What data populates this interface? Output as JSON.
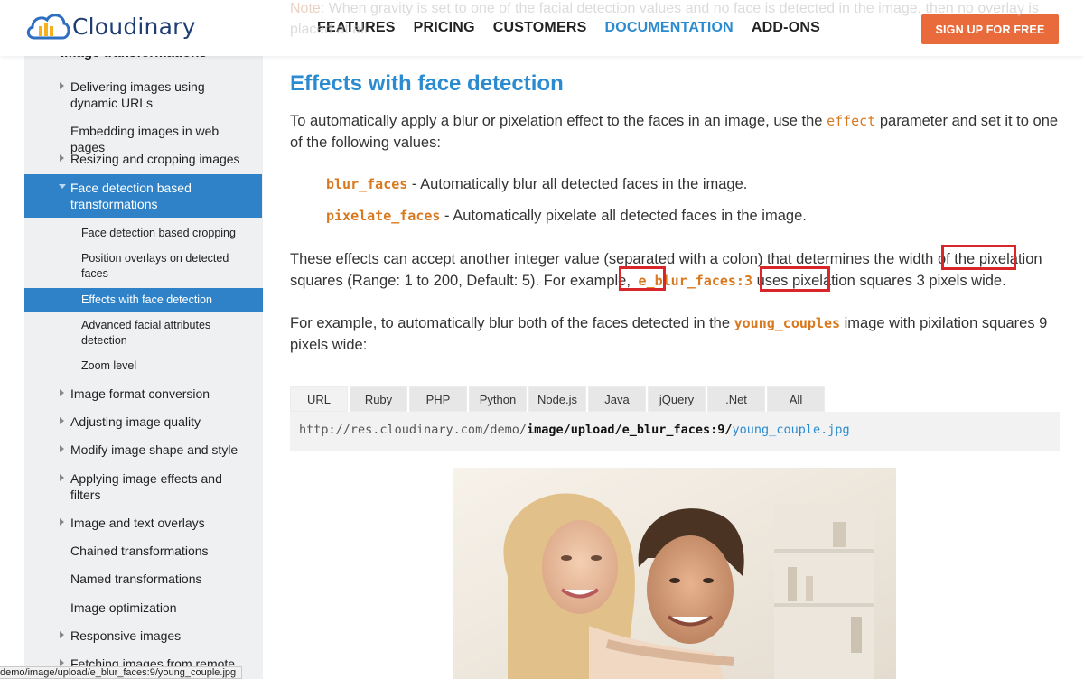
{
  "header": {
    "logo_text": "Cloudinary",
    "nav": [
      "FEATURES",
      "PRICING",
      "CUSTOMERS",
      "DOCUMENTATION",
      "ADD-ONS"
    ],
    "active_nav": "DOCUMENTATION",
    "signup_label": "SIGN UP FOR FREE"
  },
  "note": {
    "label": "Note:",
    "text": "When gravity is set to one of the facial detection values and no face is detected in the image, then no overlay is placed at all."
  },
  "sidebar": {
    "section_title": "Image transformations",
    "items": [
      {
        "label": "Delivering images using dynamic URLs",
        "arrow": true
      },
      {
        "label": "Embedding images in web pages",
        "arrow": false
      },
      {
        "label": "Resizing and cropping images",
        "arrow": true
      },
      {
        "label": "Face detection based transformations",
        "arrow": true,
        "expanded": true
      },
      {
        "label": "Image format conversion",
        "arrow": true
      },
      {
        "label": "Adjusting image quality",
        "arrow": true
      },
      {
        "label": "Modify image shape and style",
        "arrow": true
      },
      {
        "label": "Applying image effects and filters",
        "arrow": true
      },
      {
        "label": "Image and text overlays",
        "arrow": true
      },
      {
        "label": "Chained transformations",
        "arrow": false
      },
      {
        "label": "Named transformations",
        "arrow": false
      },
      {
        "label": "Image optimization",
        "arrow": false
      },
      {
        "label": "Responsive images",
        "arrow": true
      },
      {
        "label": "Fetching images from remote",
        "arrow": true
      }
    ],
    "sub_items": [
      {
        "label": "Face detection based cropping"
      },
      {
        "label": "Position overlays on detected faces"
      },
      {
        "label": "Effects with face detection",
        "selected": true
      },
      {
        "label": "Advanced facial attributes detection"
      },
      {
        "label": "Zoom level"
      }
    ]
  },
  "content": {
    "heading": "Effects with face detection",
    "intro_before": "To automatically apply a blur or pixelation effect to the faces in an image, use the",
    "intro_code": "effect",
    "intro_after": "parameter and set it to one of the following values:",
    "bullets": [
      {
        "code": "blur_faces",
        "text": "- Automatically blur all detected faces in the image."
      },
      {
        "code": "pixelate_faces",
        "text": "- Automatically pixelate all detected faces in the image."
      }
    ],
    "effects_p1": "These effects can accept another integer value (separated with a colon) that determines the width of the",
    "effects_word": "pixelation",
    "effects_p2": "squares (Range: 1 to 200, Default: 5). For example,",
    "effects_code": "e_blur_faces:3",
    "effects_p3": "uses",
    "effects_word2": "pixelation",
    "effects_p4": "squares 3 pixels wide.",
    "example_before": "For example, to automatically blur both of the faces detected in the",
    "example_code": "young_couples",
    "example_after": "image with pixilation squares 9 pixels wide:",
    "tabs": [
      "URL",
      "Ruby",
      "PHP",
      "Python",
      "Node.js",
      "Java",
      "jQuery",
      ".Net",
      "All"
    ],
    "active_tab": "URL",
    "url": {
      "prefix": "http://res.cloudinary.com/demo/",
      "path": "image/upload/e_blur_faces:9/",
      "file": "young_couple.jpg"
    }
  },
  "statusbar": {
    "text": "demo/image/upload/e_blur_faces:9/young_couple.jpg"
  },
  "colors": {
    "accent_blue": "#2a8bd0",
    "sidebar_active": "#2f82c7",
    "signup_orange": "#e96a3a",
    "code_orange": "#d9791f",
    "highlight_red": "#d8262b"
  }
}
